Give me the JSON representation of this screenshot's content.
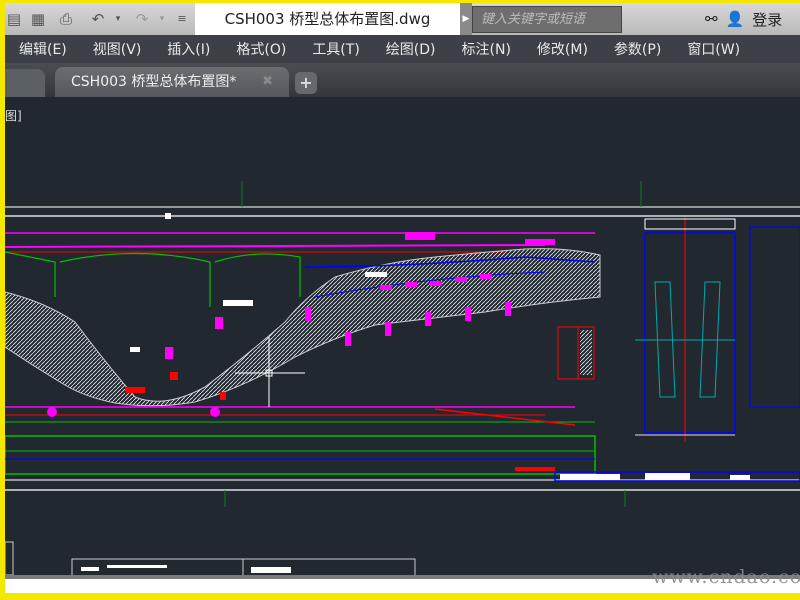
{
  "window": {
    "title": "CSH003 桥型总体布置图.dwg"
  },
  "quick_access": {
    "icons": [
      "save-icon",
      "save-as-icon",
      "plot-icon",
      "undo-icon",
      "redo-icon",
      "customize-icon"
    ]
  },
  "search": {
    "placeholder": "键入关键字或短语"
  },
  "user": {
    "login_label": "登录"
  },
  "menu": [
    "编辑(E)",
    "视图(V)",
    "插入(I)",
    "格式(O)",
    "工具(T)",
    "绘图(D)",
    "标注(N)",
    "修改(M)",
    "参数(P)",
    "窗口(W)"
  ],
  "tabs": [
    {
      "label": "CSH003 桥型总体布置图*"
    }
  ],
  "viewport": {
    "label": "图]"
  },
  "watermark": "www.cndao.com",
  "colors": {
    "canvas": "#212830",
    "border": "#f5e800",
    "magenta": "#ff00ff",
    "green": "#00b000",
    "blue": "#0000ff",
    "red": "#ff0000"
  }
}
